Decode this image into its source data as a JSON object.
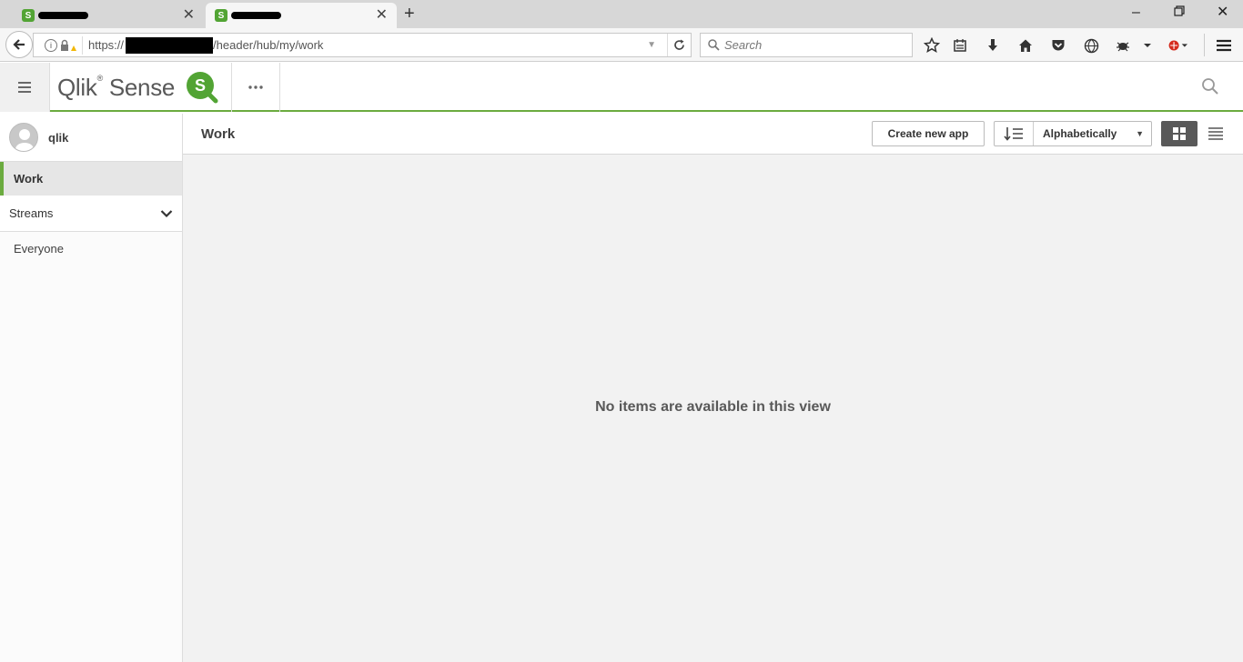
{
  "browser": {
    "tabs": [
      {
        "favicon": "S"
      },
      {
        "favicon": "S"
      }
    ],
    "url": {
      "prefix": "https://",
      "suffix": "/header/hub/my/work"
    },
    "search_placeholder": "Search"
  },
  "header": {
    "logo_text": "Qlik",
    "logo_product": "Sense",
    "logo_badge": "S"
  },
  "sidebar": {
    "user_name": "qlik",
    "items": [
      {
        "label": "Work"
      },
      {
        "label": "Streams"
      },
      {
        "label": "Everyone"
      }
    ]
  },
  "main": {
    "title": "Work",
    "create_button": "Create new app",
    "sort_label": "Alphabetically",
    "empty_message": "No items are available in this view"
  },
  "colors": {
    "accent": "#6bab3f",
    "grid_active": "#595959",
    "background": "#f2f2f2"
  }
}
